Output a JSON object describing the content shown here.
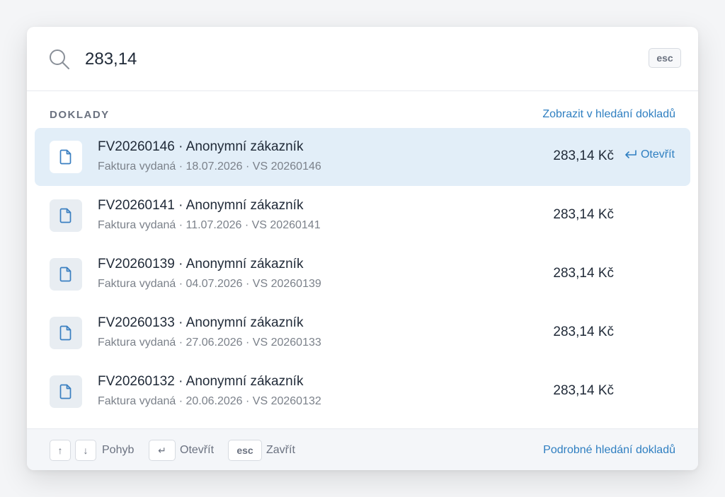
{
  "search": {
    "value": "283,14",
    "esc_label": "esc"
  },
  "section": {
    "title": "DOKLADY",
    "link": "Zobrazit v hledání dokladů"
  },
  "results": [
    {
      "title": "FV20260146 · Anonymní zákazník",
      "subtitle": "Faktura vydaná · 18.07.2026 · VS 20260146",
      "amount": "283,14 Kč",
      "open_label": "Otevřít",
      "selected": true
    },
    {
      "title": "FV20260141 · Anonymní zákazník",
      "subtitle": "Faktura vydaná · 11.07.2026 · VS 20260141",
      "amount": "283,14 Kč"
    },
    {
      "title": "FV20260139 · Anonymní zákazník",
      "subtitle": "Faktura vydaná · 04.07.2026 · VS 20260139",
      "amount": "283,14 Kč"
    },
    {
      "title": "FV20260133 · Anonymní zákazník",
      "subtitle": "Faktura vydaná · 27.06.2026 · VS 20260133",
      "amount": "283,14 Kč"
    },
    {
      "title": "FV20260132 · Anonymní zákazník",
      "subtitle": "Faktura vydaná · 20.06.2026 · VS 20260132",
      "amount": "283,14 Kč"
    }
  ],
  "footer": {
    "up_key": "↑",
    "down_key": "↓",
    "move_label": "Pohyb",
    "enter_key": "↵",
    "open_label": "Otevřít",
    "esc_key": "esc",
    "close_label": "Zavřít",
    "advanced_link": "Podrobné hledání dokladů"
  },
  "colors": {
    "accent": "#2f7fc1",
    "selected_row": "#e2eef8",
    "muted_text": "#7b818a"
  },
  "icons": {
    "search": "search-icon",
    "document": "document-icon",
    "enter": "enter-icon"
  }
}
